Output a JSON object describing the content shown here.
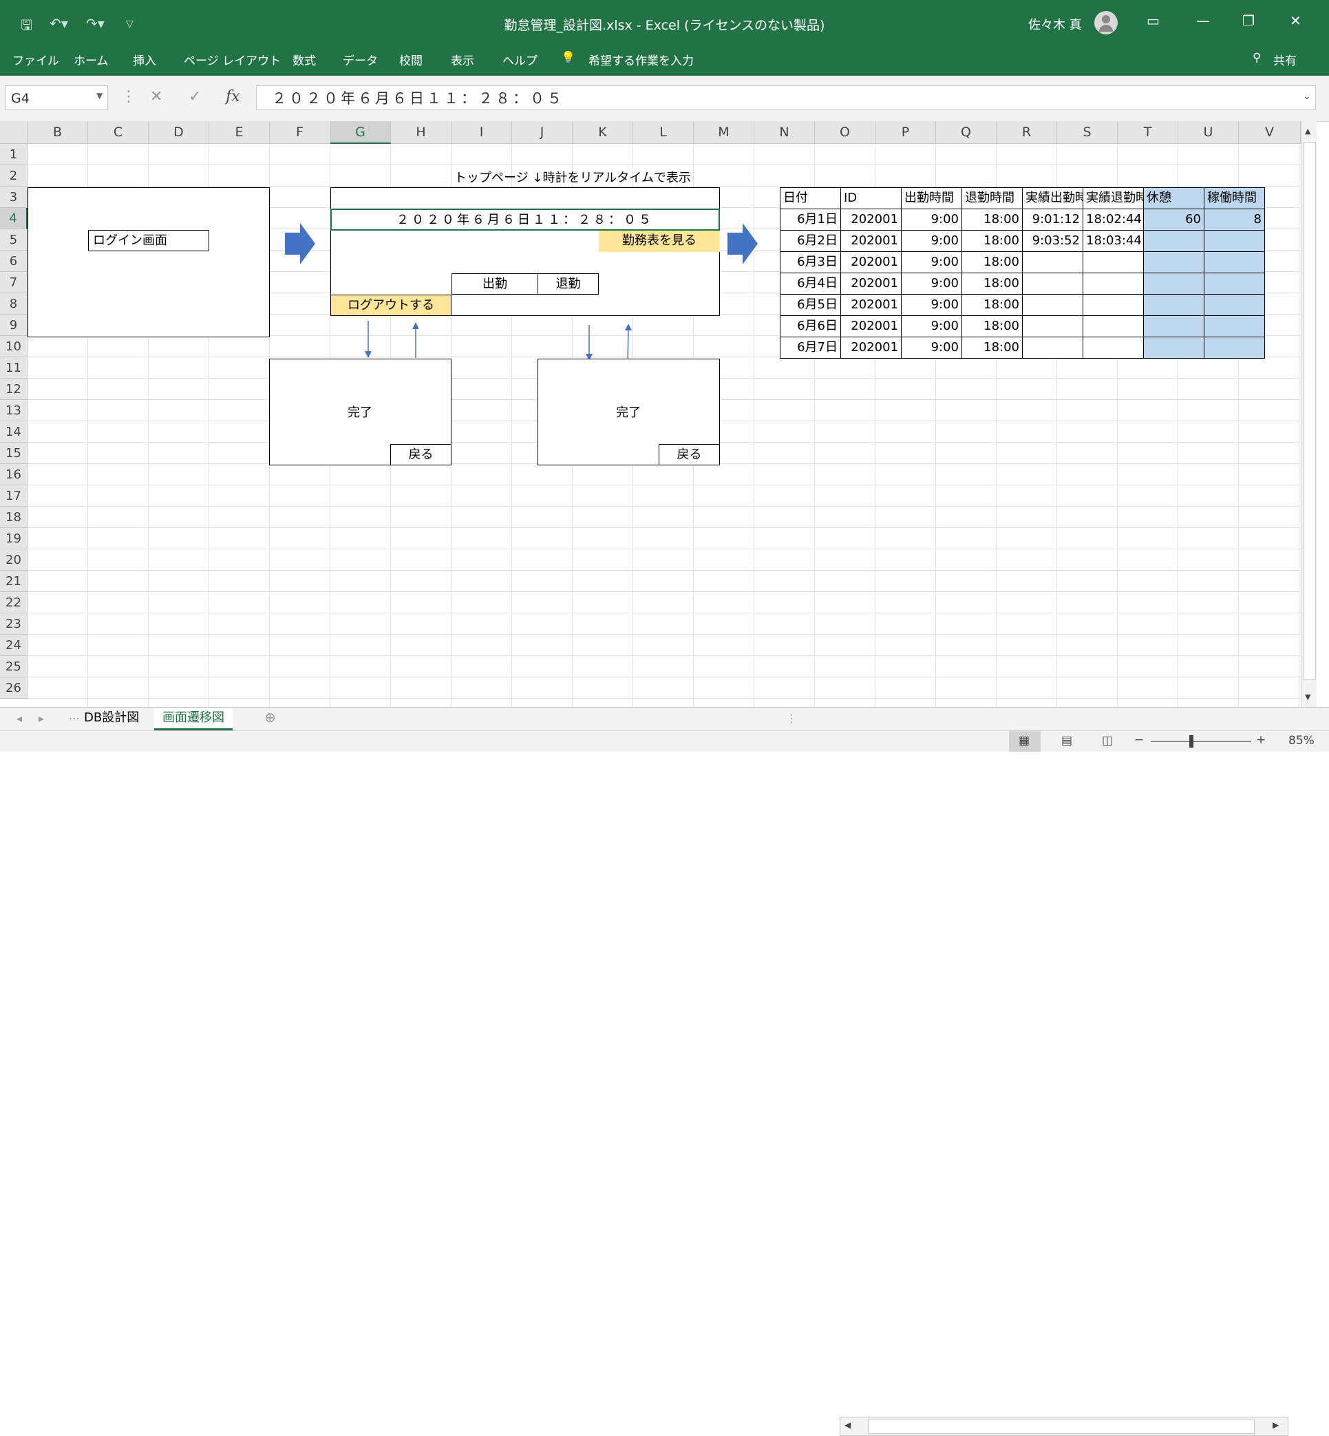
{
  "window": {
    "title": "勤怠管理_設計図.xlsx  -  Excel (ライセンスのない製品)",
    "user": "佐々木 真"
  },
  "ribbon": {
    "tabs": [
      "ファイル",
      "ホーム",
      "挿入",
      "ページ レイアウト",
      "数式",
      "データ",
      "校閲",
      "表示",
      "ヘルプ"
    ],
    "tell_me": "希望する作業を入力",
    "share": "共有"
  },
  "formula_bar": {
    "name_box": "G4",
    "formula": "２０２０年６月６日１１：２８：０５"
  },
  "columns": [
    "B",
    "C",
    "D",
    "E",
    "F",
    "G",
    "H",
    "I",
    "J",
    "K",
    "L",
    "M",
    "N",
    "O",
    "P",
    "Q",
    "R",
    "S",
    "T",
    "U",
    "V"
  ],
  "rows": [
    "1",
    "2",
    "3",
    "4",
    "5",
    "6",
    "7",
    "8",
    "9",
    "10",
    "11",
    "12",
    "13",
    "14",
    "15",
    "16",
    "17",
    "18",
    "19",
    "20",
    "21",
    "22",
    "23",
    "24",
    "25",
    "26"
  ],
  "sheet": {
    "login_label": "ログイン画面",
    "top_page_note": "トップページ ↓時計をリアルタイムで表示",
    "clock": "２０２０年６月６日１１：２８：０５",
    "view_schedule": "勤務表を見る",
    "clock_in": "出勤",
    "clock_out": "退勤",
    "logout": "ログアウトする",
    "complete_left": "完了",
    "back_left": "戻る",
    "complete_right": "完了",
    "back_right": "戻る"
  },
  "attendance": {
    "headers": [
      "日付",
      "ID",
      "出勤時間",
      "退勤時間",
      "実績出勤時",
      "実績退勤時",
      "休憩",
      "稼働時間"
    ],
    "rows": [
      [
        "6月1日",
        "202001",
        "9:00",
        "18:00",
        "9:01:12",
        "18:02:44",
        "60",
        "8"
      ],
      [
        "6月2日",
        "202001",
        "9:00",
        "18:00",
        "9:03:52",
        "18:03:44",
        "",
        ""
      ],
      [
        "6月3日",
        "202001",
        "9:00",
        "18:00",
        "",
        "",
        "",
        ""
      ],
      [
        "6月4日",
        "202001",
        "9:00",
        "18:00",
        "",
        "",
        "",
        ""
      ],
      [
        "6月5日",
        "202001",
        "9:00",
        "18:00",
        "",
        "",
        "",
        ""
      ],
      [
        "6月6日",
        "202001",
        "9:00",
        "18:00",
        "",
        "",
        "",
        ""
      ],
      [
        "6月7日",
        "202001",
        "9:00",
        "18:00",
        "",
        "",
        "",
        ""
      ]
    ]
  },
  "sheet_tabs": [
    "DB設計図",
    "画面遷移図"
  ],
  "status": {
    "zoom": "85%"
  },
  "colors": {
    "excel_green": "#217346",
    "yellow": "#ffe699",
    "blue": "#bdd7ee",
    "arrow": "#4472c4"
  }
}
